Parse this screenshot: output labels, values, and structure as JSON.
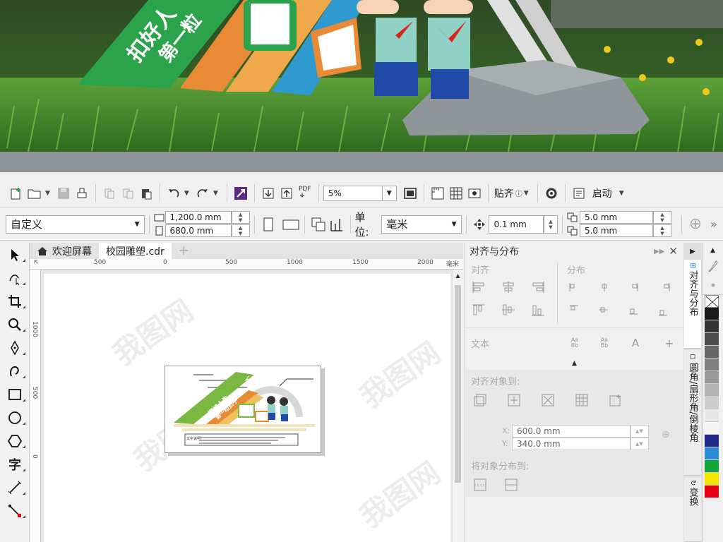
{
  "photo": {
    "sign_line1": "扣好人",
    "sign_line2": "第一粒"
  },
  "toolbar": {
    "zoom_value": "5%",
    "snap_label": "贴齐",
    "launch_label": "启动",
    "pdf_label": "PDF"
  },
  "propbar": {
    "preset": "自定义",
    "width": "1,200.0 mm",
    "height": "680.0 mm",
    "units_label": "单位:",
    "units_value": "毫米",
    "nudge": "0.1 mm",
    "dup_x": "5.0 mm",
    "dup_y": "5.0 mm"
  },
  "tabs": [
    {
      "label": "欢迎屏幕"
    },
    {
      "label": "校园雕塑.cdr"
    }
  ],
  "ruler": {
    "h_ticks": [
      "500",
      "0",
      "500",
      "1000",
      "1500",
      "2000"
    ],
    "h_unit": "毫米",
    "v_ticks": [
      "1000",
      "500",
      "0"
    ]
  },
  "artboard": {
    "sign_text1": "扣好人生",
    "sign_text2": "第一粒扣子",
    "label": "文字说明"
  },
  "docker": {
    "title": "对齐与分布",
    "align_label": "对齐",
    "distribute_label": "分布",
    "text_label": "文本",
    "align_to_label": "对齐对象到:",
    "x_value": "600.0 mm",
    "y_value": "340.0 mm",
    "x_label": "X:",
    "y_label": "Y:",
    "distribute_to_label": "将对象分布到:"
  },
  "vtabs": [
    "对齐与分布",
    "圆角/扇形角/倒棱角",
    "变换"
  ],
  "palette": [
    "#ffffff",
    "#1a1a1a",
    "#333333",
    "#4d4d4d",
    "#666666",
    "#808080",
    "#999999",
    "#b3b3b3",
    "#cccccc",
    "#e6e6e6",
    "#f5f5f5",
    "#1f2a8c",
    "#2b8ad6",
    "#13a538",
    "#f5e400",
    "#e60012"
  ],
  "watermark": "我图网"
}
